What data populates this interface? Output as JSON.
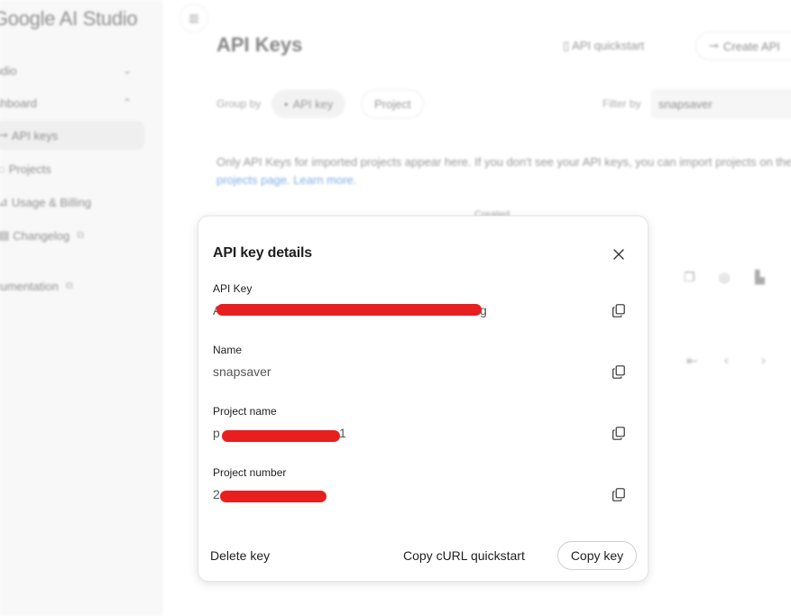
{
  "app": {
    "brand": "Google AI Studio"
  },
  "sidebar": {
    "items": [
      {
        "label": "udio",
        "state": "collapsed"
      },
      {
        "label": "shboard",
        "state": "expanded"
      },
      {
        "label": "API keys",
        "active": true
      },
      {
        "label": "Projects"
      },
      {
        "label": "Usage & Billing"
      },
      {
        "label": "Changelog",
        "external": true
      },
      {
        "label": "cumentation",
        "external": true
      }
    ]
  },
  "header": {
    "title": "API Keys",
    "quickstart_label": "API quickstart",
    "create_label": "Create API"
  },
  "filters": {
    "group_by_label": "Group by",
    "chips": [
      {
        "label": "API key",
        "selected": true
      },
      {
        "label": "Project",
        "selected": false
      }
    ],
    "filter_by_label": "Filter by",
    "filter_value": "snapsaver"
  },
  "info": {
    "text": "Only API Keys for imported projects appear here. If you don't see your API keys, you can import projects on the",
    "link1": "projects page.",
    "link2": "Learn more."
  },
  "table": {
    "created_header": "Created"
  },
  "modal": {
    "title": "API key details",
    "fields": [
      {
        "label": "API Key",
        "value_start": "A",
        "value_end": "g"
      },
      {
        "label": "Name",
        "value": "snapsaver"
      },
      {
        "label": "Project name",
        "value_start": "p",
        "value_end": "1"
      },
      {
        "label": "Project number",
        "value_start": "2"
      }
    ],
    "actions": {
      "delete_label": "Delete key",
      "curl_label": "Copy cURL quickstart",
      "copy_label": "Copy key"
    }
  },
  "colors": {
    "redaction": "#e81f1f",
    "link": "#1a66d9"
  }
}
